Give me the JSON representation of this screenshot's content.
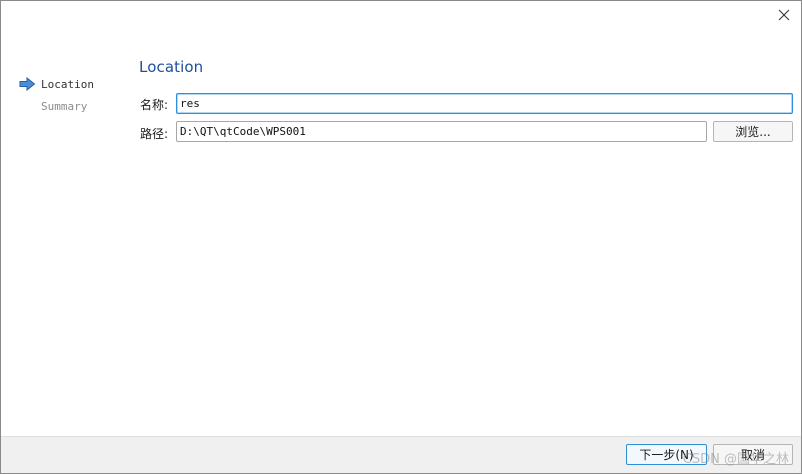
{
  "window": {
    "close_icon": "close-icon"
  },
  "steps": [
    {
      "label": "Location",
      "active": true
    },
    {
      "label": "Summary",
      "active": false
    }
  ],
  "page": {
    "title": "Location"
  },
  "form": {
    "name_label": "名称:",
    "name_value": "res",
    "path_label": "路径:",
    "path_value": "D:\\QT\\qtCode\\WPS001",
    "browse_label": "浏览..."
  },
  "footer": {
    "next_label": "下一步(N)",
    "cancel_label": "取消"
  },
  "watermark": {
    "text": "CSDN @国华之林"
  },
  "colors": {
    "accent": "#2f8fd8",
    "title": "#1f4e9c",
    "arrow": "#4a90d9"
  }
}
